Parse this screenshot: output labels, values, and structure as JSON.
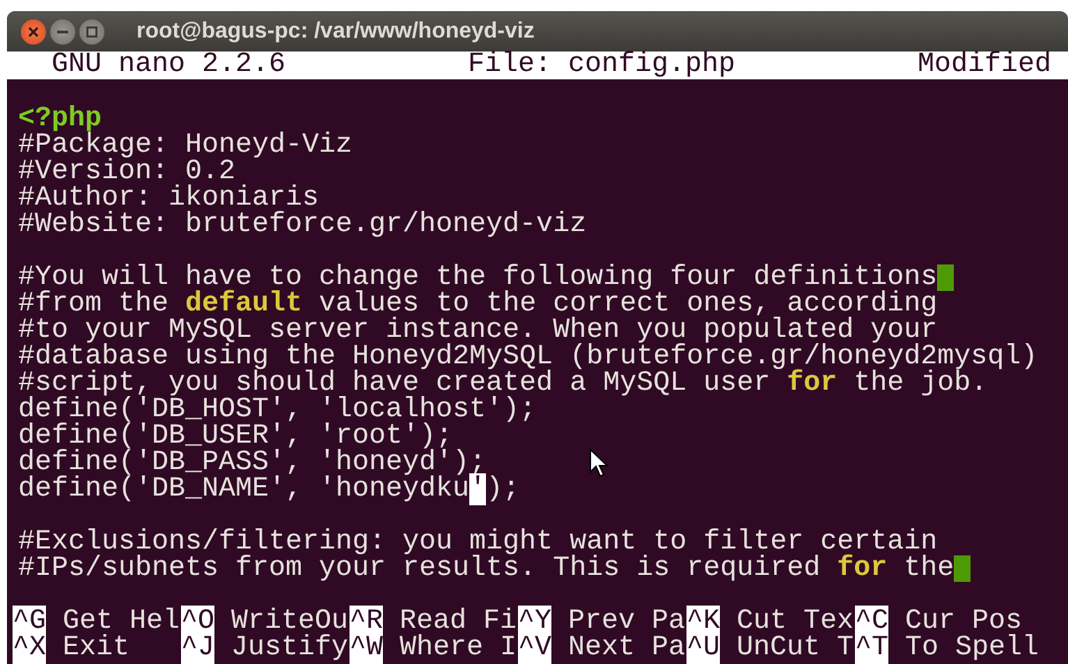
{
  "window": {
    "title": "root@bagus-pc: /var/www/honeyd-viz"
  },
  "nano_header": {
    "version": "GNU nano 2.2.6",
    "file": "File: config.php",
    "status": "Modified"
  },
  "lines": [
    {
      "kind": "blank"
    },
    {
      "kind": "code",
      "trailing_whitespace": false,
      "segments": [
        {
          "kind": "php-tag",
          "text": "<?php"
        }
      ]
    },
    {
      "kind": "code",
      "trailing_whitespace": false,
      "segments": [
        {
          "kind": "plain",
          "text": "#Package: Honeyd-Viz"
        }
      ]
    },
    {
      "kind": "code",
      "trailing_whitespace": false,
      "segments": [
        {
          "kind": "plain",
          "text": "#Version: 0.2"
        }
      ]
    },
    {
      "kind": "code",
      "trailing_whitespace": false,
      "segments": [
        {
          "kind": "plain",
          "text": "#Author: ikoniaris"
        }
      ]
    },
    {
      "kind": "code",
      "trailing_whitespace": false,
      "segments": [
        {
          "kind": "plain",
          "text": "#Website: bruteforce.gr/honeyd-viz"
        }
      ]
    },
    {
      "kind": "blank"
    },
    {
      "kind": "code",
      "trailing_whitespace": true,
      "segments": [
        {
          "kind": "plain",
          "text": "#You will have to change the following four definitions"
        }
      ]
    },
    {
      "kind": "code",
      "trailing_whitespace": false,
      "segments": [
        {
          "kind": "plain",
          "text": "#from the "
        },
        {
          "kind": "keyword",
          "text": "default"
        },
        {
          "kind": "plain",
          "text": " values to the correct ones, according"
        }
      ]
    },
    {
      "kind": "code",
      "trailing_whitespace": false,
      "segments": [
        {
          "kind": "plain",
          "text": "#to your MySQL server instance. When you populated your"
        }
      ]
    },
    {
      "kind": "code",
      "trailing_whitespace": false,
      "segments": [
        {
          "kind": "plain",
          "text": "#database using the Honeyd2MySQL (bruteforce.gr/honeyd2mysql)"
        }
      ]
    },
    {
      "kind": "code",
      "trailing_whitespace": false,
      "segments": [
        {
          "kind": "plain",
          "text": "#script, you should have created a MySQL user "
        },
        {
          "kind": "keyword",
          "text": "for"
        },
        {
          "kind": "plain",
          "text": " the job."
        }
      ]
    },
    {
      "kind": "code",
      "trailing_whitespace": false,
      "segments": [
        {
          "kind": "plain",
          "text": "define('DB_HOST', 'localhost');"
        }
      ]
    },
    {
      "kind": "code",
      "trailing_whitespace": false,
      "segments": [
        {
          "kind": "plain",
          "text": "define('DB_USER', 'root');"
        }
      ]
    },
    {
      "kind": "code",
      "trailing_whitespace": false,
      "segments": [
        {
          "kind": "plain",
          "text": "define('DB_PASS', 'honeyd');"
        }
      ]
    },
    {
      "kind": "code",
      "trailing_whitespace": false,
      "segments": [
        {
          "kind": "plain",
          "text": "define('DB_NAME', 'honeydku"
        },
        {
          "kind": "cursor",
          "text": "'"
        },
        {
          "kind": "plain",
          "text": ");"
        }
      ]
    },
    {
      "kind": "blank"
    },
    {
      "kind": "code",
      "trailing_whitespace": false,
      "segments": [
        {
          "kind": "plain",
          "text": "#Exclusions/filtering: you might want to filter certain"
        }
      ]
    },
    {
      "kind": "code",
      "trailing_whitespace": true,
      "segments": [
        {
          "kind": "plain",
          "text": "#IPs/subnets from your results. This is required "
        },
        {
          "kind": "keyword",
          "text": "for"
        },
        {
          "kind": "plain",
          "text": " the"
        }
      ]
    },
    {
      "kind": "blank"
    }
  ],
  "shortcut_rows": [
    {
      "items": [
        {
          "key": "^G",
          "label": "Get Hel"
        },
        {
          "key": "^O",
          "label": "WriteOu"
        },
        {
          "key": "^R",
          "label": "Read Fi"
        },
        {
          "key": "^Y",
          "label": "Prev Pa"
        },
        {
          "key": "^K",
          "label": "Cut Tex"
        },
        {
          "key": "^C",
          "label": "Cur Pos"
        }
      ]
    },
    {
      "items": [
        {
          "key": "^X",
          "label": "Exit"
        },
        {
          "key": "^J",
          "label": "Justify"
        },
        {
          "key": "^W",
          "label": "Where I"
        },
        {
          "key": "^V",
          "label": "Next Pa"
        },
        {
          "key": "^U",
          "label": "UnCut T"
        },
        {
          "key": "^T",
          "label": "To Spell"
        }
      ]
    }
  ]
}
